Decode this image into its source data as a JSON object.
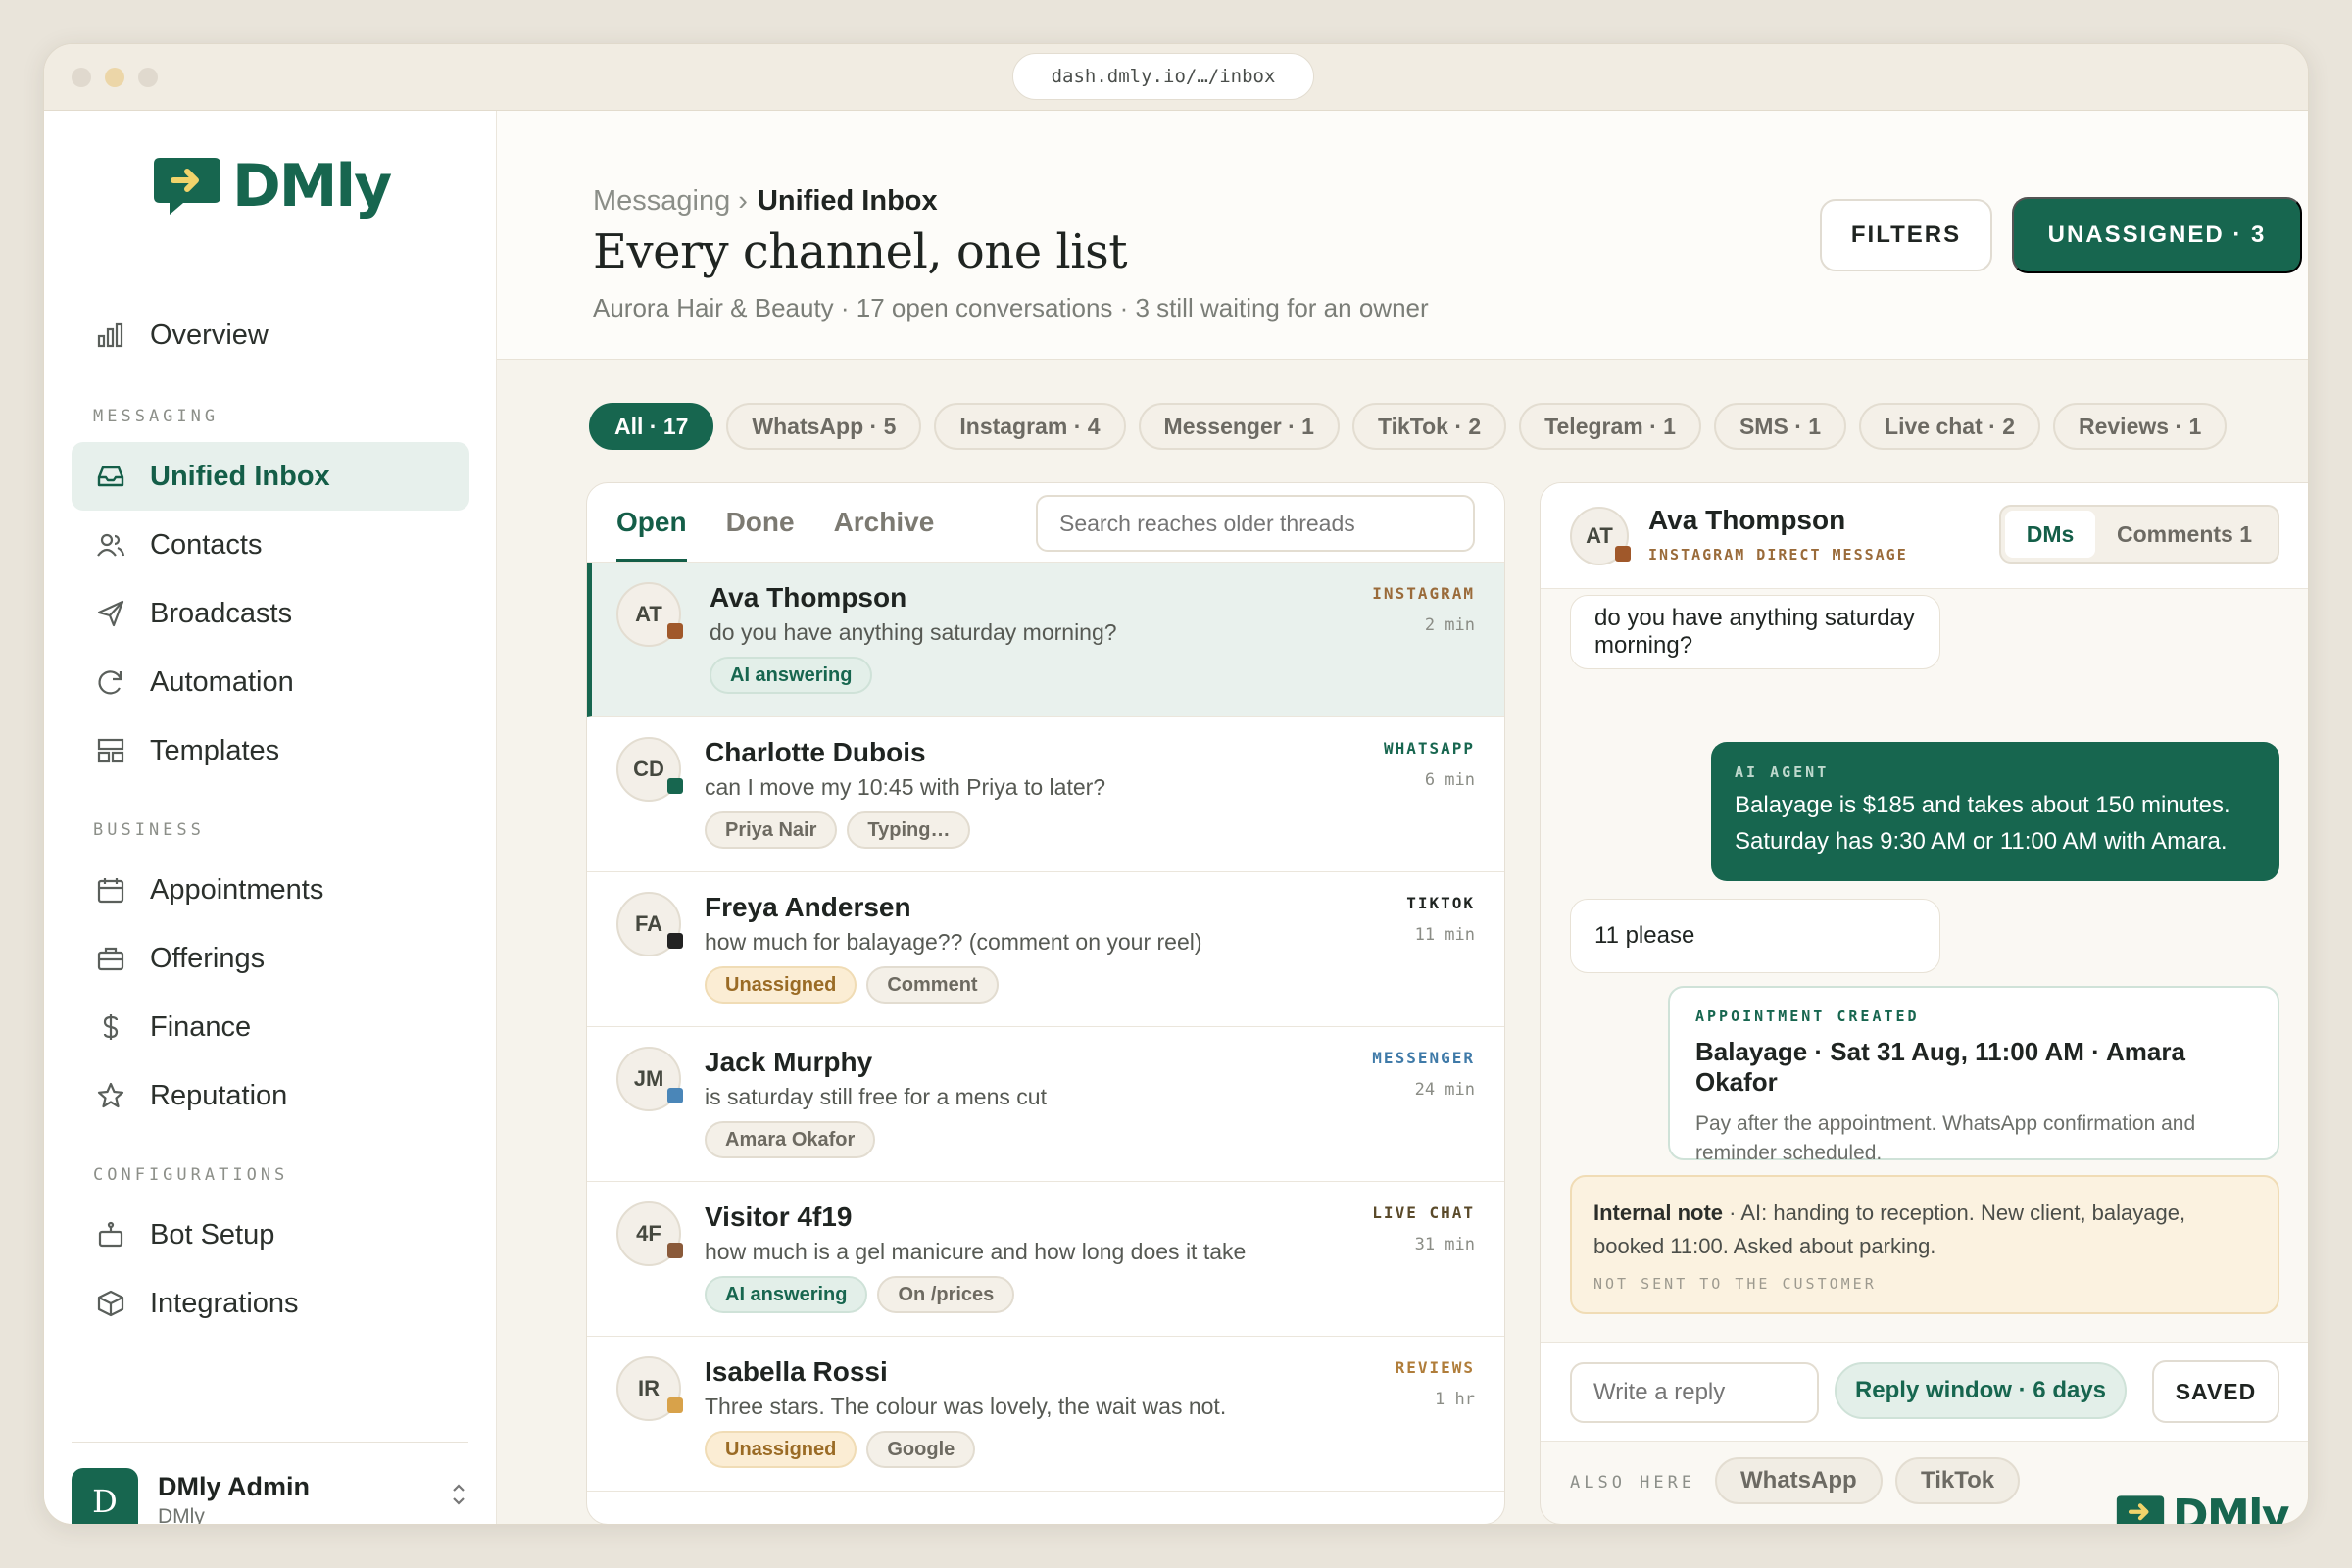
{
  "browser": {
    "url": "dash.dmly.io/…/inbox"
  },
  "brand": {
    "name": "DMly",
    "accent": "#17664f"
  },
  "sidebar": {
    "overview": "Overview",
    "sections": {
      "messaging": "MESSAGING",
      "business": "BUSINESS",
      "configurations": "CONFIGURATIONS"
    },
    "messaging": [
      {
        "label": "Unified Inbox",
        "icon": "inbox-icon",
        "active": true
      },
      {
        "label": "Contacts",
        "icon": "contacts-icon"
      },
      {
        "label": "Broadcasts",
        "icon": "send-icon"
      },
      {
        "label": "Automation",
        "icon": "refresh-icon"
      },
      {
        "label": "Templates",
        "icon": "templates-icon"
      }
    ],
    "business": [
      {
        "label": "Appointments",
        "icon": "calendar-icon"
      },
      {
        "label": "Offerings",
        "icon": "briefcase-icon"
      },
      {
        "label": "Finance",
        "icon": "dollar-icon"
      },
      {
        "label": "Reputation",
        "icon": "star-icon"
      }
    ],
    "configurations": [
      {
        "label": "Bot Setup",
        "icon": "bot-icon"
      },
      {
        "label": "Integrations",
        "icon": "cube-icon"
      }
    ],
    "admin": {
      "initial": "D",
      "name": "DMly Admin",
      "org": "DMly"
    }
  },
  "header": {
    "breadcrumb_parent": "Messaging ›",
    "breadcrumb_current": "Unified Inbox",
    "title": "Every channel, one list",
    "subtitle": "Aurora Hair & Beauty · 17 open conversations · 3 still waiting for an owner",
    "filters_label": "FILTERS",
    "unassigned_label": "UNASSIGNED · 3"
  },
  "channel_filters": [
    "All · 17",
    "WhatsApp · 5",
    "Instagram · 4",
    "Messenger · 1",
    "TikTok · 2",
    "Telegram · 1",
    "SMS · 1",
    "Live chat · 2",
    "Reviews · 1"
  ],
  "list": {
    "tabs": [
      "Open",
      "Done",
      "Archive"
    ],
    "search_placeholder": "Search reaches older threads",
    "rows": [
      {
        "initials": "AT",
        "name": "Ava Thompson",
        "message": "do you have anything saturday morning?",
        "channel": "INSTAGRAM",
        "channel_color": "#9a6b3a",
        "dot_color": "#a0582a",
        "time": "2 min",
        "tags": [
          {
            "label": "AI answering",
            "kind": "ai"
          }
        ]
      },
      {
        "initials": "CD",
        "name": "Charlotte Dubois",
        "message": "can I move my 10:45 with Priya to later?",
        "channel": "WHATSAPP",
        "channel_color": "#17664f",
        "dot_color": "#17664f",
        "time": "6 min",
        "tags": [
          {
            "label": "Priya Nair",
            "kind": "plain"
          },
          {
            "label": "Typing…",
            "kind": "plain"
          }
        ]
      },
      {
        "initials": "FA",
        "name": "Freya Andersen",
        "message": "how much for balayage?? (comment on your reel)",
        "channel": "TIKTOK",
        "channel_color": "#1f2421",
        "dot_color": "#222222",
        "time": "11 min",
        "tags": [
          {
            "label": "Unassigned",
            "kind": "un"
          },
          {
            "label": "Comment",
            "kind": "plain"
          }
        ]
      },
      {
        "initials": "JM",
        "name": "Jack Murphy",
        "message": "is saturday still free for a mens cut",
        "channel": "MESSENGER",
        "channel_color": "#3f7aa8",
        "dot_color": "#4a86b8",
        "time": "24 min",
        "tags": [
          {
            "label": "Amara Okafor",
            "kind": "plain"
          }
        ]
      },
      {
        "initials": "4F",
        "name": "Visitor 4f19",
        "message": "how much is a gel manicure and how long does it take",
        "channel": "LIVE CHAT",
        "channel_color": "#5a4a2a",
        "dot_color": "#8a5a3a",
        "time": "31 min",
        "tags": [
          {
            "label": "AI answering",
            "kind": "ai"
          },
          {
            "label": "On /prices",
            "kind": "plain"
          }
        ]
      },
      {
        "initials": "IR",
        "name": "Isabella Rossi",
        "message": "Three stars. The colour was lovely, the wait was not.",
        "channel": "REVIEWS",
        "channel_color": "#b07d3a",
        "dot_color": "#d8a24a",
        "time": "1 hr",
        "tags": [
          {
            "label": "Unassigned",
            "kind": "un"
          },
          {
            "label": "Google",
            "kind": "plain"
          }
        ]
      }
    ]
  },
  "conversation": {
    "initials": "AT",
    "name": "Ava Thompson",
    "channel_label": "INSTAGRAM DIRECT MESSAGE",
    "tabs": {
      "dms": "DMs",
      "comments": "Comments 1"
    },
    "msg1": "do you have anything saturday morning?",
    "ai_label": "AI AGENT",
    "ai_line1": "Balayage is $185 and takes about 150 minutes.",
    "ai_line2": "Saturday has 9:30 AM or 11:00 AM with Amara.",
    "msg2": "11 please",
    "appt_label": "APPOINTMENT CREATED",
    "appt_title": "Balayage · Sat 31 Aug, 11:00 AM · Amara Okafor",
    "appt_desc": "Pay after the appointment. WhatsApp confirmation and reminder scheduled.",
    "note_title": "Internal note",
    "note_body": " · AI: handing to reception. New client, balayage, booked 11:00. Asked about parking.",
    "note_sub": "NOT SENT TO THE CUSTOMER",
    "reply_placeholder": "Write a reply",
    "reply_window": "Reply window · 6 days",
    "saved_label": "SAVED",
    "also_label": "ALSO HERE",
    "also": [
      "WhatsApp",
      "TikTok"
    ]
  }
}
